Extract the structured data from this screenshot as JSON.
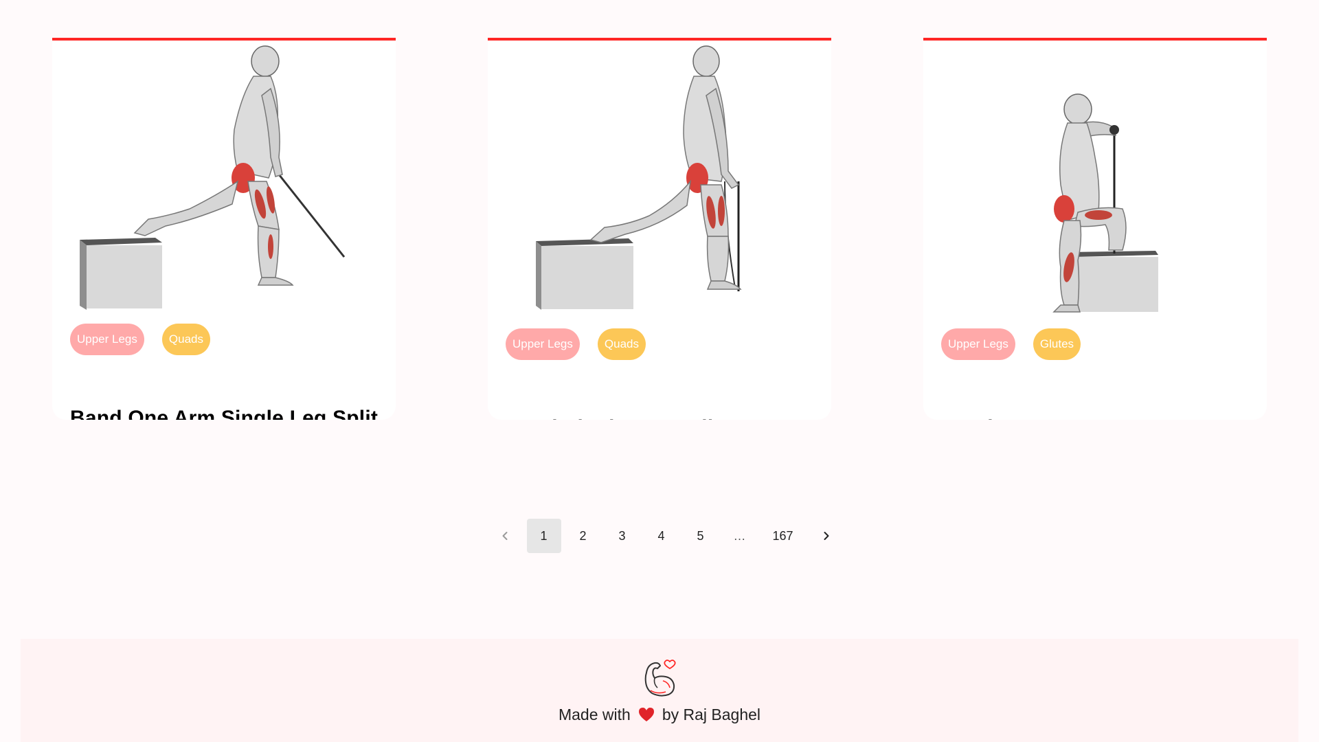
{
  "exercises": [
    {
      "name": "Band One Arm Single Leg Split Squat",
      "body_part": "Upper Legs",
      "target": "Quads",
      "image_icon": "exercise-illustration-icon"
    },
    {
      "name": "Band Single Leg Split Squat",
      "body_part": "Upper Legs",
      "target": "Quads",
      "image_icon": "exercise-illustration-icon"
    },
    {
      "name": "Band Step-Up",
      "body_part": "Upper Legs",
      "target": "Glutes",
      "image_icon": "exercise-illustration-icon"
    }
  ],
  "pagination": {
    "pages": [
      "1",
      "2",
      "3",
      "4",
      "5"
    ],
    "ellipsis": "…",
    "last_page": "167",
    "current_page": "1",
    "prev_icon": "chevron-left-icon",
    "next_icon": "chevron-right-icon"
  },
  "footer": {
    "made_with": "Made with",
    "by_author": "by Raj Baghel",
    "logo_icon": "bicep-heart-icon",
    "heart_icon": "heart-icon"
  },
  "colors": {
    "accent_red": "#ff2625",
    "body_part_tag": "#ffa9a9",
    "target_tag": "#fcc757",
    "footer_bg": "#fff3f4",
    "page_bg": "#fffafb"
  }
}
